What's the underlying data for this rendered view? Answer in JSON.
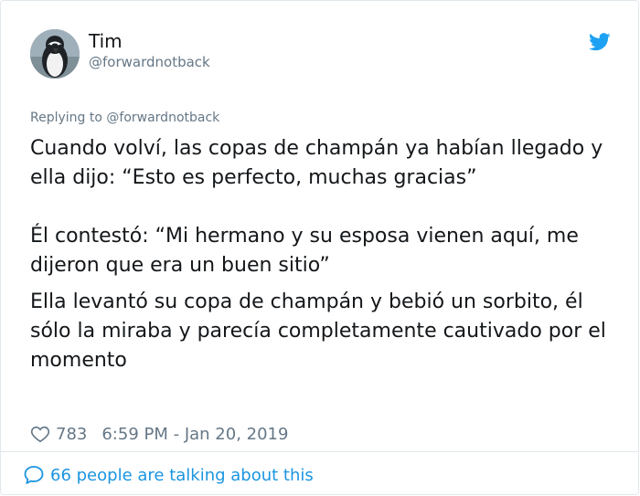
{
  "tweet": {
    "user": {
      "name": "Tim",
      "handle": "@forwardnotback",
      "avatar_icon": "penguin-avatar"
    },
    "platform_icon": "twitter-bird-icon",
    "replying_prefix": "Replying to",
    "replying_handle": "@forwardnotback",
    "paragraphs": [
      "Cuando volví, las copas de champán ya habían llegado y ella dijo: “Esto es perfecto, muchas gracias”",
      "Él contestó: “Mi hermano y su esposa vienen aquí, me dijeron que era un buen sitio”",
      "Ella levantó su copa de champán y bebió un sorbito, él sólo la miraba y parecía completamente cautivado por el momento"
    ],
    "likes": "783",
    "timestamp": "6:59 PM - Jan 20, 2019",
    "talking": "66 people are talking about this"
  },
  "colors": {
    "text": "#14171a",
    "muted": "#657786",
    "accent": "#1b95e0",
    "border": "#e1e8ed"
  }
}
